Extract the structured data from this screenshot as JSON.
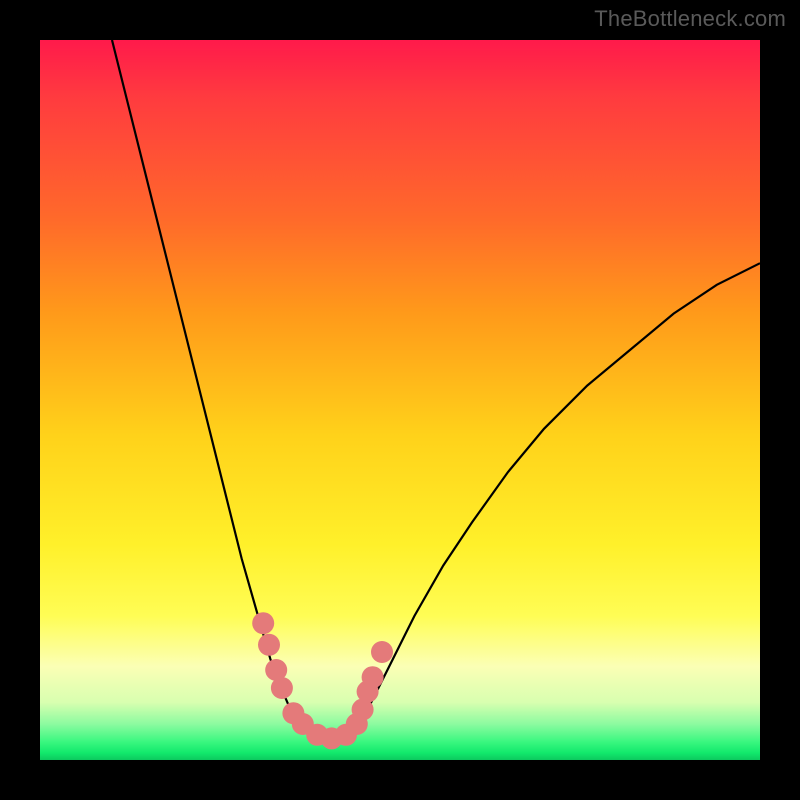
{
  "watermark": "TheBottleneck.com",
  "colors": {
    "background": "#000000",
    "curve": "#000000",
    "dot": "#e47a7a",
    "gradient_top": "#ff1a4b",
    "gradient_mid": "#fff02a",
    "gradient_bottom": "#0cc95e"
  },
  "chart_data": {
    "type": "line",
    "title": "",
    "xlabel": "",
    "ylabel": "",
    "ylim": [
      0,
      100
    ],
    "xlim": [
      0,
      100
    ],
    "series": [
      {
        "name": "left-curve",
        "x": [
          10,
          12,
          14,
          16,
          18,
          20,
          22,
          24,
          26,
          28,
          30,
          32,
          33.5,
          35,
          36.5
        ],
        "y": [
          100,
          92,
          84,
          76,
          68,
          60,
          52,
          44,
          36,
          28,
          21,
          14,
          10,
          6.5,
          4.5
        ]
      },
      {
        "name": "valley",
        "x": [
          36.5,
          38,
          39.5,
          41,
          42.5,
          44
        ],
        "y": [
          4.5,
          3.2,
          2.8,
          2.8,
          3.2,
          4.5
        ]
      },
      {
        "name": "right-curve",
        "x": [
          44,
          46,
          49,
          52,
          56,
          60,
          65,
          70,
          76,
          82,
          88,
          94,
          100
        ],
        "y": [
          4.5,
          8,
          14,
          20,
          27,
          33,
          40,
          46,
          52,
          57,
          62,
          66,
          69
        ]
      }
    ],
    "dots": {
      "name": "highlight-dots",
      "points": [
        {
          "x": 31.0,
          "y": 19.0
        },
        {
          "x": 31.8,
          "y": 16.0
        },
        {
          "x": 32.8,
          "y": 12.5
        },
        {
          "x": 33.6,
          "y": 10.0
        },
        {
          "x": 35.2,
          "y": 6.5
        },
        {
          "x": 36.5,
          "y": 5.0
        },
        {
          "x": 38.5,
          "y": 3.5
        },
        {
          "x": 40.5,
          "y": 3.0
        },
        {
          "x": 42.5,
          "y": 3.5
        },
        {
          "x": 44.0,
          "y": 5.0
        },
        {
          "x": 44.8,
          "y": 7.0
        },
        {
          "x": 45.5,
          "y": 9.5
        },
        {
          "x": 46.2,
          "y": 11.5
        },
        {
          "x": 47.5,
          "y": 15.0
        }
      ]
    }
  }
}
